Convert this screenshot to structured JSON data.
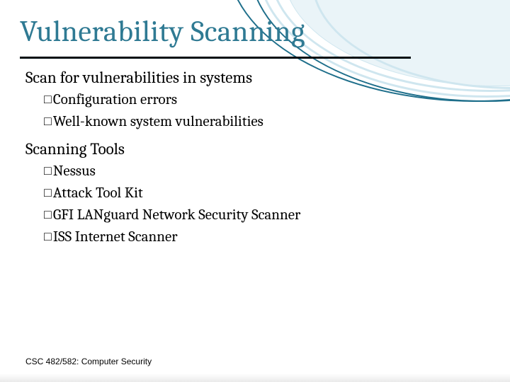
{
  "title": "Vulnerability Scanning",
  "bullet_marker": "□",
  "sections": [
    {
      "heading": "Scan for vulnerabilities in systems",
      "items": [
        "Configuration errors",
        "Well-known system vulnerabilities"
      ]
    },
    {
      "heading": "Scanning Tools",
      "items": [
        "Nessus",
        "Attack Tool Kit",
        "GFI LANguard Network Security Scanner",
        "ISS Internet Scanner"
      ]
    }
  ],
  "footer": "CSC 482/582: Computer Security"
}
